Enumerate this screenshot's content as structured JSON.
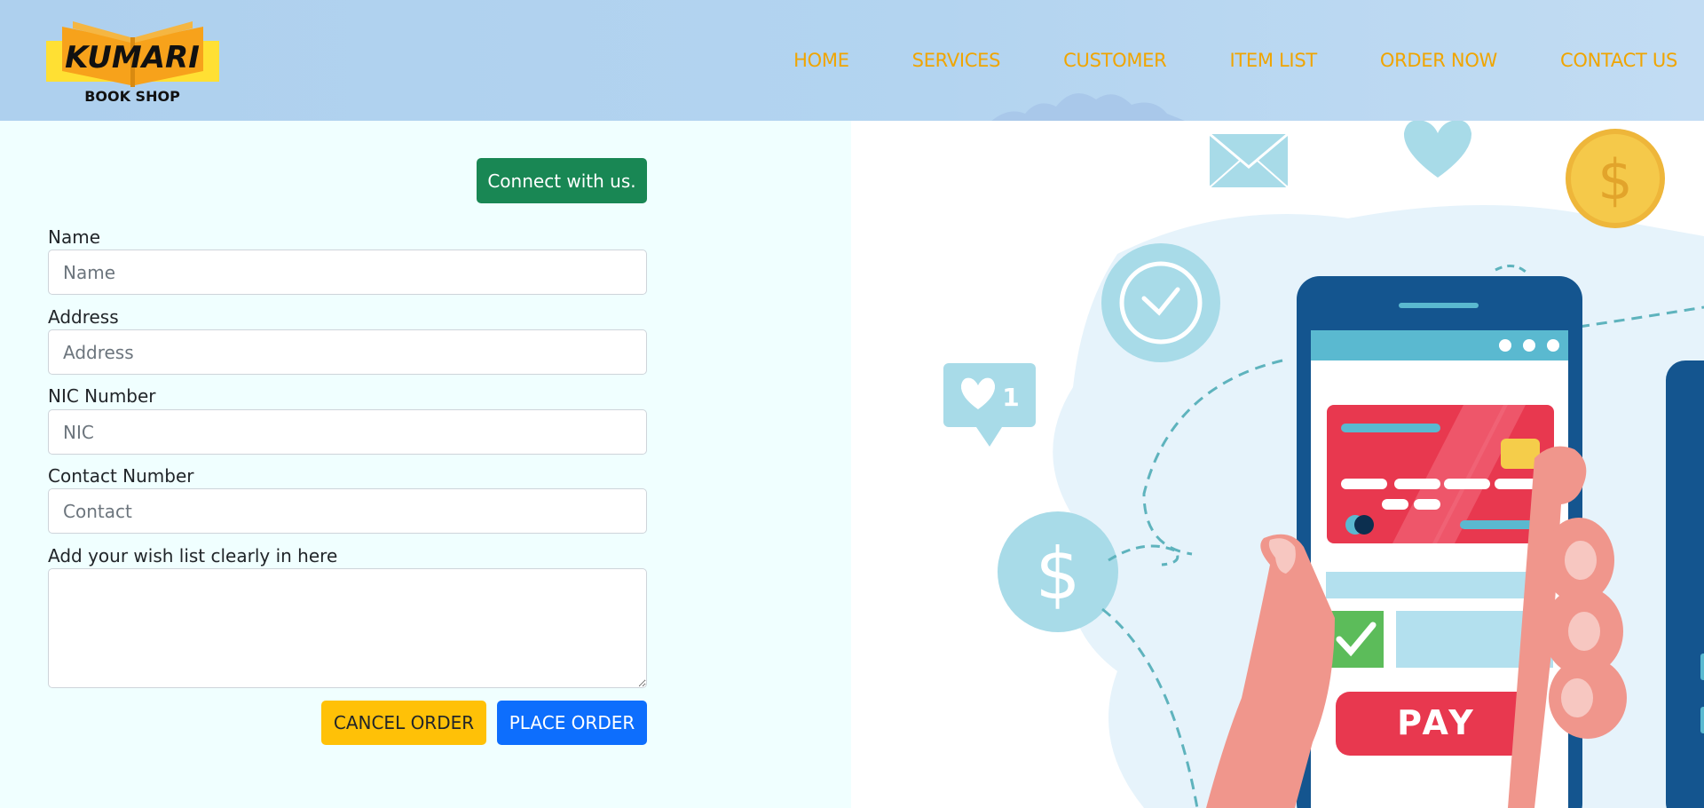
{
  "brand": {
    "logo_title": "KUMARI",
    "logo_subtitle": "BOOK SHOP"
  },
  "nav": {
    "items": [
      "HOME",
      "SERVICES",
      "CUSTOMER",
      "ITEM LIST",
      "ORDER NOW",
      "CONTACT US"
    ]
  },
  "form": {
    "connect_label": "Connect with us.",
    "name_label": "Name",
    "name_placeholder": "Name",
    "address_label": "Address",
    "address_placeholder": "Address",
    "nic_label": "NIC Number",
    "nic_placeholder": "NIC",
    "contact_label": "Contact Number",
    "contact_placeholder": "Contact",
    "wishlist_label": "Add your wish list clearly in here",
    "cancel_label": "CANCEL ORDER",
    "place_label": "PLACE ORDER"
  },
  "illustration": {
    "pay_label": "PAY",
    "like_count": "1",
    "icons": [
      "mail-icon",
      "heart-icon",
      "dollar-coin-icon",
      "clock-icon",
      "like-bubble-icon",
      "dollar-circle-icon",
      "smartphone",
      "credit-card-icon",
      "checkmark-icon"
    ],
    "colors": {
      "accent_nav": "#f0a500",
      "connect_button": "#198754",
      "cancel_button": "#ffc107",
      "place_button": "#0d6efd",
      "pay_button": "#e8384f"
    }
  }
}
